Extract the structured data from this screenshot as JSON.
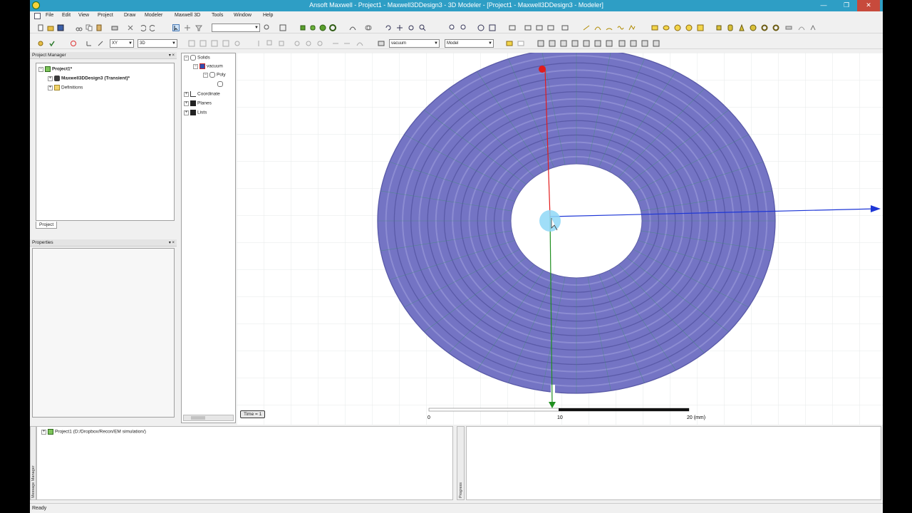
{
  "window": {
    "title": "Ansoft Maxwell - Project1 - Maxwell3DDesign3 - 3D Modeler - [Project1 - Maxwell3DDesign3 - Modeler]",
    "min_glyph": "—",
    "max_glyph": "❐",
    "close_glyph": "✕"
  },
  "menu": [
    "File",
    "Edit",
    "View",
    "Project",
    "Draw",
    "Modeler",
    "Maxwell 3D",
    "Tools",
    "Window",
    "Help"
  ],
  "toolbar": {
    "plane_select": "XY",
    "dim_select": "3D",
    "material_select": "vacuum",
    "mode_select": "Model"
  },
  "project_manager": {
    "title": "Project Manager",
    "pin": "▾ ×",
    "project": "Project1*",
    "design": "Maxwell3DDesign3 (Transient)*",
    "definitions": "Definitions",
    "tab": "Project"
  },
  "model_tree": {
    "solids": "Solids",
    "vacuum": "vacuum",
    "poly": "Poly",
    "coordinate": "Coordinate",
    "planes": "Planes",
    "lists": "Lists"
  },
  "properties": {
    "title": "Properties",
    "pin": "▾ ×"
  },
  "viewport": {
    "time_label": "Time = 1",
    "scale_ticks": [
      "0",
      "10",
      "20 (mm)"
    ],
    "coil_color": "#7474c4",
    "coil_line_color": "#3e8f70",
    "x_axis_color": "#e31b1b",
    "y_axis_color": "#1d36d6",
    "z_axis_color": "#1f8f1f"
  },
  "message_manager": {
    "label": "Message Manager",
    "entry": "Project1 (D:/Dropbox/Recon/EM simulation/)"
  },
  "progress": {
    "label": "Progress"
  },
  "status": "Ready"
}
